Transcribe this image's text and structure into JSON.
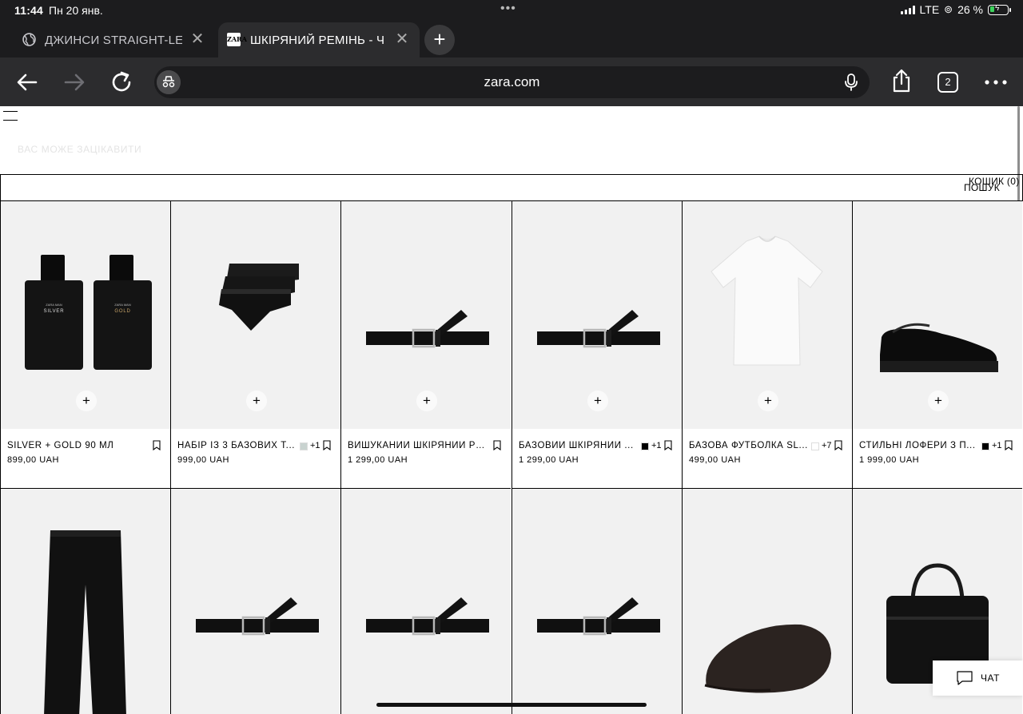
{
  "status_bar": {
    "time": "11:44",
    "date": "Пн 20 янв.",
    "network": "LTE",
    "battery": "26 %",
    "battery_level": 0.26
  },
  "tabs": [
    {
      "label": "ДЖИНСИ STRAIGHT-LE",
      "active": false
    },
    {
      "label": "ШКІРЯНИЙ РЕМІНЬ - Ч",
      "active": true,
      "favicon_text": "ZARA"
    }
  ],
  "toolbar": {
    "url": "zara.com",
    "tab_count": "2"
  },
  "page": {
    "recommendations_title": "ВАС МОЖЕ ЗАЦІКАВИТИ",
    "cart_label": "КОШИК (0)",
    "search_label": "ПОШУК",
    "add_symbol": "+",
    "chat_label": "ЧАТ"
  },
  "products_row1": [
    {
      "name": "SILVER + GOLD 90 МЛ",
      "price": "899,00 UAH",
      "swatch": null,
      "more": "",
      "image": "perfume"
    },
    {
      "name": "НАБІР ІЗ 3 БАЗОВИХ Т...",
      "price": "999,00 UAH",
      "swatch": "#c9d3d0",
      "more": "+1",
      "image": "briefs"
    },
    {
      "name": "ВИШУКАНИЙ ШКІРЯНИЙ РЕ...",
      "price": "1 299,00 UAH",
      "swatch": null,
      "more": "",
      "image": "belt"
    },
    {
      "name": "БАЗОВИЙ ШКІРЯНИЙ ...",
      "price": "1 299,00 UAH",
      "swatch": "#000000",
      "more": "+1",
      "image": "belt"
    },
    {
      "name": "БАЗОВА ФУТБОЛКА SL...",
      "price": "499,00 UAH",
      "swatch": "#ffffff",
      "more": "+7",
      "image": "tshirt"
    },
    {
      "name": "СТИЛЬНІ ЛОФЕРИ З П...",
      "price": "1 999,00 UAH",
      "swatch": "#000000",
      "more": "+1",
      "image": "loafer"
    }
  ],
  "products_row2": [
    {
      "image": "trousers"
    },
    {
      "image": "belt"
    },
    {
      "image": "belt"
    },
    {
      "image": "belt"
    },
    {
      "image": "cap"
    },
    {
      "image": "bag"
    }
  ],
  "perfume_labels": {
    "brand": "ZARA MAN",
    "left": "SILVER",
    "right": "GOLD"
  },
  "colors": {
    "chrome_bg": "#1c1c1e",
    "toolbar_bg": "#2c2c2e",
    "image_bg": "#f1f1f1",
    "battery_green": "#3cd35c"
  }
}
